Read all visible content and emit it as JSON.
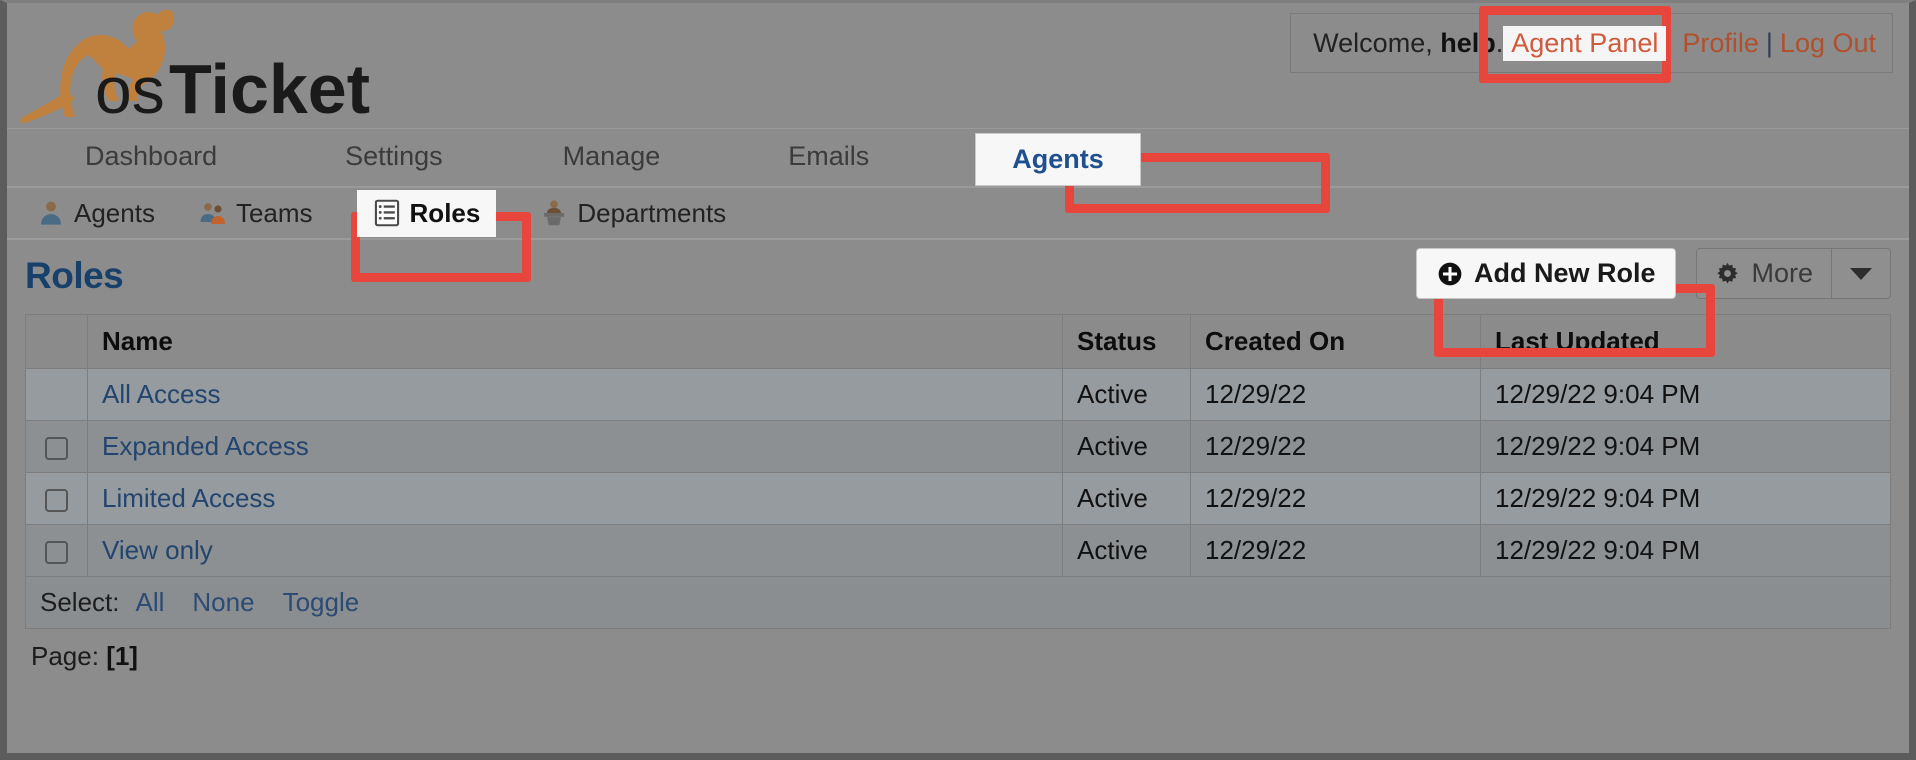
{
  "brand": {
    "logo_text": "osTicket",
    "logo_icon": "kangaroo-icon",
    "logo_accent_color": "#c0813f"
  },
  "header": {
    "welcome_prefix": "Welcome, ",
    "welcome_user": "help",
    "welcome_suffix": ".",
    "agent_panel_label": "Agent Panel",
    "profile_label": "Profile",
    "separator": "|",
    "logout_label": "Log Out"
  },
  "main_nav": {
    "items": [
      {
        "label": "Dashboard",
        "active": false
      },
      {
        "label": "Settings",
        "active": false
      },
      {
        "label": "Manage",
        "active": false
      },
      {
        "label": "Emails",
        "active": false
      },
      {
        "label": "Agents",
        "active": true
      }
    ]
  },
  "sub_nav": {
    "items": [
      {
        "label": "Agents",
        "icon": "person-icon",
        "active": false
      },
      {
        "label": "Teams",
        "icon": "people-group-icon",
        "active": false
      },
      {
        "label": "Roles",
        "icon": "clipboard-list-icon",
        "active": true
      },
      {
        "label": "Departments",
        "icon": "podium-person-icon",
        "active": false
      }
    ]
  },
  "content": {
    "page_title": "Roles",
    "add_new_role_label": "Add New Role",
    "add_new_role_icon": "plus-circle-icon",
    "more_label": "More",
    "more_icon": "gear-icon",
    "more_caret_icon": "chevron-down-icon"
  },
  "table": {
    "columns": [
      "",
      "Name",
      "Status",
      "Created On",
      "Last Updated"
    ],
    "rows": [
      {
        "selectable": false,
        "name": "All Access",
        "status": "Active",
        "created_on": "12/29/22",
        "last_updated": "12/29/22 9:04 PM"
      },
      {
        "selectable": true,
        "name": "Expanded Access",
        "status": "Active",
        "created_on": "12/29/22",
        "last_updated": "12/29/22 9:04 PM"
      },
      {
        "selectable": true,
        "name": "Limited Access",
        "status": "Active",
        "created_on": "12/29/22",
        "last_updated": "12/29/22 9:04 PM"
      },
      {
        "selectable": true,
        "name": "View only",
        "status": "Active",
        "created_on": "12/29/22",
        "last_updated": "12/29/22 9:04 PM"
      }
    ],
    "select_label": "Select:",
    "select_all": "All",
    "select_none": "None",
    "select_toggle": "Toggle"
  },
  "pagination": {
    "page_label": "Page:",
    "current_page": "[1]"
  },
  "highlights": {
    "color": "#e8453c",
    "targets": [
      "agent-panel-link",
      "agents-nav-tab",
      "roles-subnav-tab",
      "add-new-role-button"
    ]
  }
}
